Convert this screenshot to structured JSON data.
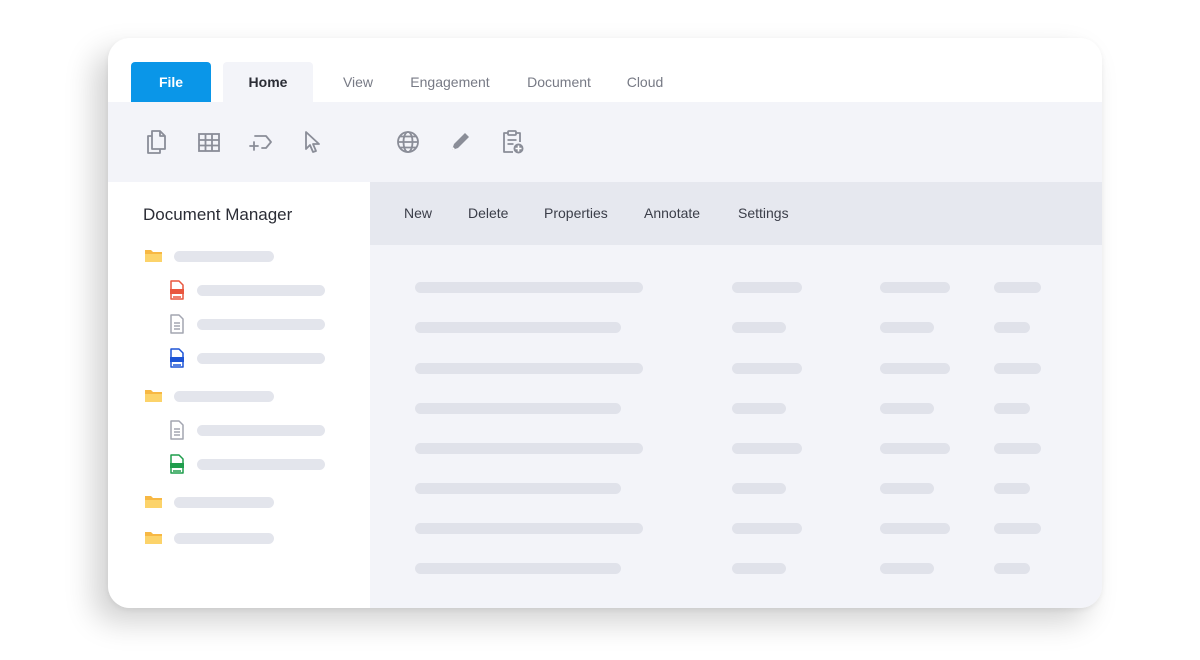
{
  "ribbon": {
    "tabs": [
      {
        "label": "File"
      },
      {
        "label": "Home"
      },
      {
        "label": "View"
      },
      {
        "label": "Engagement"
      },
      {
        "label": "Document"
      },
      {
        "label": "Cloud"
      }
    ],
    "active_tab": "Home"
  },
  "toolbar": {
    "icons": [
      "copy-icon",
      "table-icon",
      "convert-icon",
      "cursor-icon",
      "globe-icon",
      "pencil-icon",
      "clipboard-add-icon"
    ]
  },
  "sidebar": {
    "title": "Document Manager",
    "tree": [
      {
        "type": "folder",
        "icon": "folder-icon"
      },
      {
        "type": "file",
        "icon": "pdf-file-icon"
      },
      {
        "type": "file",
        "icon": "text-file-icon"
      },
      {
        "type": "file",
        "icon": "docx-file-icon"
      },
      {
        "type": "folder",
        "icon": "folder-icon"
      },
      {
        "type": "file",
        "icon": "text-file-icon"
      },
      {
        "type": "file",
        "icon": "xlsx-file-icon"
      },
      {
        "type": "folder",
        "icon": "folder-icon"
      },
      {
        "type": "folder",
        "icon": "folder-icon"
      }
    ]
  },
  "main": {
    "actions": [
      "New",
      "Delete",
      "Properties",
      "Annotate",
      "Settings"
    ],
    "row_count": 8
  },
  "colors": {
    "accent": "#0a96e8",
    "folder": "#f7b844",
    "pdf": "#e9573f",
    "docx": "#1e55d6",
    "xlsx": "#1f9d4c"
  }
}
